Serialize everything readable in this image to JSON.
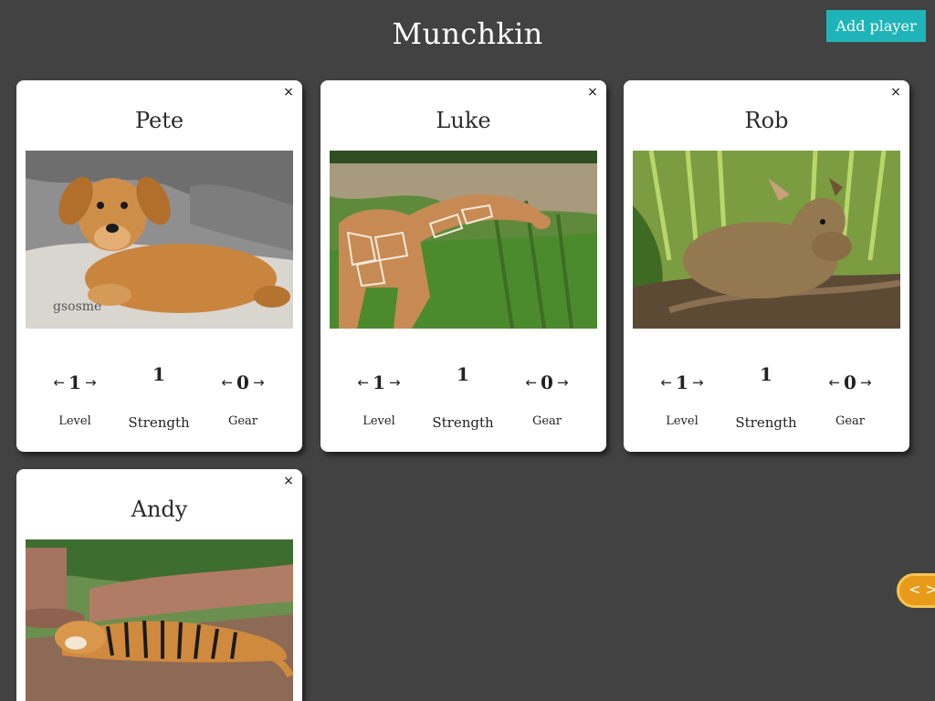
{
  "app": {
    "title": "Munchkin"
  },
  "header": {
    "add_player_label": "Add player"
  },
  "players": [
    {
      "name": "Pete",
      "level": "1",
      "strength": "1",
      "gear": "0",
      "photo": "puppy-photo",
      "photo_text": "gsosme"
    },
    {
      "name": "Luke",
      "level": "1",
      "strength": "1",
      "gear": "0",
      "photo": "giraffe-photo"
    },
    {
      "name": "Rob",
      "level": "1",
      "strength": "1",
      "gear": "0",
      "photo": "deer-photo"
    },
    {
      "name": "Andy",
      "photo": "tiger-photo"
    }
  ],
  "labels": {
    "level": "Level",
    "strength": "Strength",
    "gear": "Gear",
    "close": "×",
    "dec": "←",
    "inc": "→"
  },
  "floating": {
    "code_toggle_label": "< >"
  },
  "colors": {
    "background": "#424242",
    "accent": "#1fb5b8",
    "toggle": "#e89b1a"
  }
}
